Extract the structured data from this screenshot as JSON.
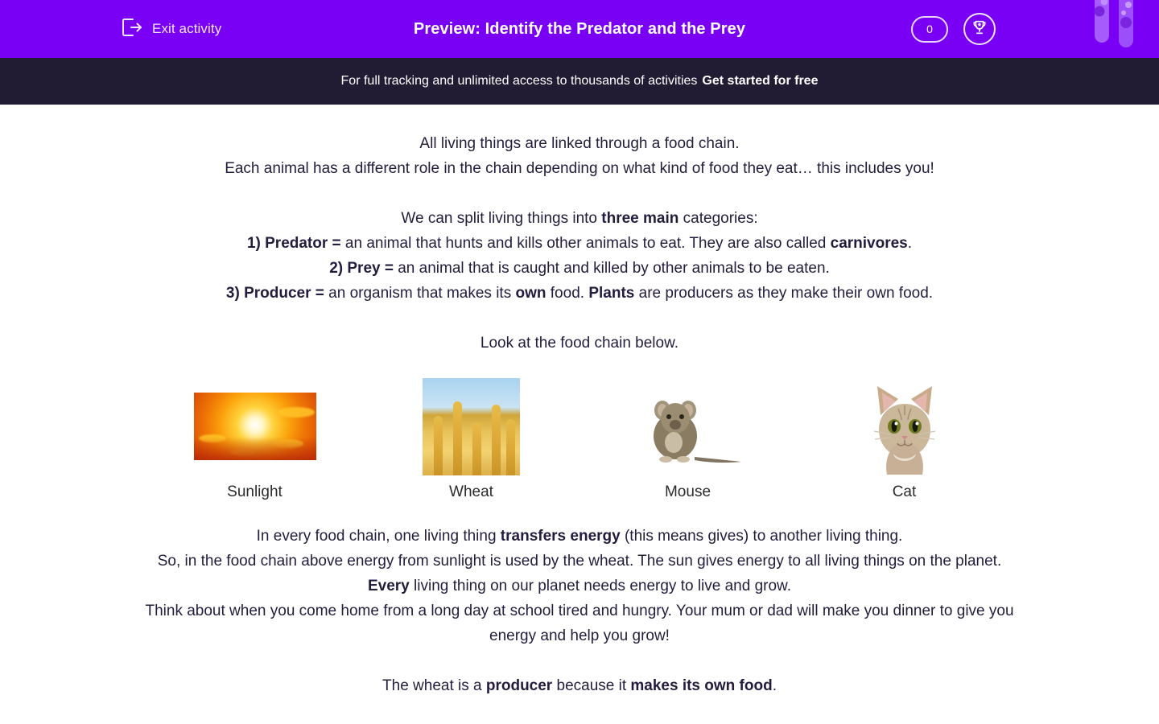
{
  "colors": {
    "brand_purple": "#7a00f5",
    "promo_dark": "#211b33",
    "text_dark": "#241c3d",
    "accent_light": "#f0e6ff"
  },
  "topbar": {
    "exit_label": "Exit activity",
    "exit_icon": "exit-arrow-icon",
    "title": "Preview: Identify the Predator and the Prey",
    "score": "0",
    "trophy_icon": "trophy-icon",
    "vials_icon": "test-tubes-decoration-icon"
  },
  "promo": {
    "text": "For full tracking and unlimited access to thousands of activities",
    "cta": "Get started for free"
  },
  "intro": {
    "line1": "All living things are linked through a food chain.",
    "line2": "Each animal has a different role in the chain depending on what kind of food they eat… this includes you!"
  },
  "categories": {
    "heading_pre": "We can split living things into ",
    "heading_bold": "three main",
    "heading_post": " categories:",
    "items": [
      {
        "number_term": "1) Predator =",
        "text_a": " an animal that hunts and kills other animals to eat. They are also called ",
        "bold_b": "carnivores",
        "text_c": "."
      },
      {
        "number_term": "2) Prey =",
        "text_a": " an animal that is caught and killed by other animals to be eaten.",
        "bold_b": "",
        "text_c": ""
      },
      {
        "number_term": "3) Producer =",
        "text_a": " an organism that makes its ",
        "bold_b": "own",
        "text_c": " food. "
      }
    ],
    "producer_tail_bold": "Plants",
    "producer_tail_text": " are producers as they make their own food."
  },
  "food_chain": {
    "prompt": "Look at the food chain below.",
    "items": [
      {
        "label": "Sunlight",
        "image": "sunlight-photo"
      },
      {
        "label": "Wheat",
        "image": "wheat-photo"
      },
      {
        "label": "Mouse",
        "image": "mouse-photo"
      },
      {
        "label": "Cat",
        "image": "cat-photo"
      }
    ]
  },
  "energy": {
    "l1_a": "In every food chain, one living thing ",
    "l1_bold": "transfers energy",
    "l1_b": " (this means gives) to another living thing.",
    "l2": "So, in the food chain above energy from sunlight is used by the wheat. The sun gives energy to all living things on the planet.",
    "l3_bold": "Every",
    "l3_text": " living thing on our planet needs energy to live and grow.",
    "l4": "Think about when you come home from a long day at school tired and hungry. Your mum or dad will make you dinner to give you energy and help you grow!"
  },
  "closing": {
    "a": "The wheat is a ",
    "bold_b": "producer",
    "c": " because it ",
    "bold_d": "makes its own food",
    "e": "."
  }
}
